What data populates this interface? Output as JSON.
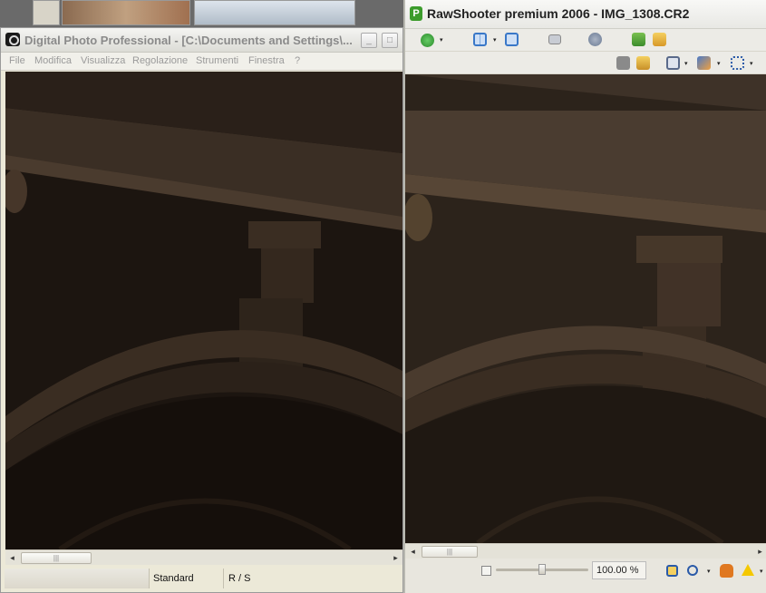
{
  "dpp": {
    "title": "Digital Photo Professional - [C:\\Documents and Settings\\...",
    "minimize_glyph": "_",
    "maximize_glyph": "□",
    "menu": [
      "File",
      "Modifica",
      "Visualizza",
      "Regolazione",
      "Strumenti",
      "Finestra",
      "?"
    ],
    "status": {
      "picture_style": "Standard",
      "rs": "R / S"
    },
    "scroll_left": "◂",
    "scroll_right": "▸",
    "scroll_grip": "|||"
  },
  "rawshooter": {
    "logo": "P",
    "title": "RawShooter premium 2006 - IMG_1308.CR2",
    "toolbar1_icons": [
      "help-icon",
      "split-view-icon",
      "single-view-icon",
      "screen-icon",
      "settings-icon",
      "download-icon",
      "batch-icon"
    ],
    "toolbar2_icons": [
      "snapshot-icon",
      "add-snapshot-icon",
      "crop-icon",
      "brush-icon",
      "selection-icon"
    ],
    "zoom": "100.00 %",
    "scroll_left": "◂",
    "scroll_right": "▸",
    "scroll_grip": "|||",
    "bottom_icons": [
      "focus-icon",
      "magnifier-icon",
      "hand-icon",
      "warning-icon"
    ],
    "colors": {
      "logo": "#3c9c2c",
      "warning": "#f5c800",
      "hand": "#e07820"
    }
  }
}
